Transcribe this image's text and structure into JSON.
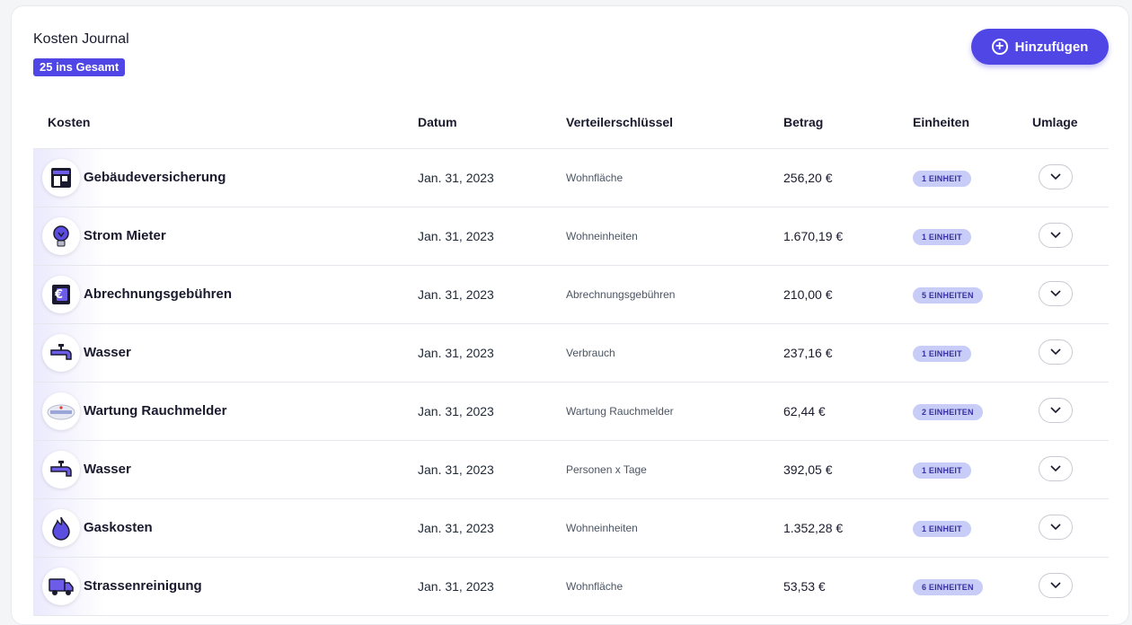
{
  "header": {
    "title": "Kosten Journal",
    "total_badge": "25 ins Gesamt",
    "add_button_label": "Hinzufügen"
  },
  "columns": {
    "kosten": "Kosten",
    "datum": "Datum",
    "verteilerschluessel": "Verteilerschlüssel",
    "betrag": "Betrag",
    "einheiten": "Einheiten",
    "umlage": "Umlage"
  },
  "rows": [
    {
      "icon": "building-icon",
      "name": "Gebäudeversicherung",
      "date": "Jan. 31, 2023",
      "key": "Wohnfläche",
      "amount": "256,20 €",
      "units": "1 EINHEIT"
    },
    {
      "icon": "lightbulb-icon",
      "name": "Strom Mieter",
      "date": "Jan. 31, 2023",
      "key": "Wohneinheiten",
      "amount": "1.670,19 €",
      "units": "1 EINHEIT"
    },
    {
      "icon": "euro-document-icon",
      "name": "Abrechnungsgebühren",
      "date": "Jan. 31, 2023",
      "key": "Abrechnungsgebühren",
      "amount": "210,00 €",
      "units": "5 EINHEITEN"
    },
    {
      "icon": "faucet-icon",
      "name": "Wasser",
      "date": "Jan. 31, 2023",
      "key": "Verbrauch",
      "amount": "237,16 €",
      "units": "1 EINHEIT"
    },
    {
      "icon": "smoke-detector-icon",
      "name": "Wartung Rauchmelder",
      "date": "Jan. 31, 2023",
      "key": "Wartung Rauchmelder",
      "amount": "62,44 €",
      "units": "2 EINHEITEN"
    },
    {
      "icon": "faucet-icon",
      "name": "Wasser",
      "date": "Jan. 31, 2023",
      "key": "Personen x Tage",
      "amount": "392,05 €",
      "units": "1 EINHEIT"
    },
    {
      "icon": "flame-icon",
      "name": "Gaskosten",
      "date": "Jan. 31, 2023",
      "key": "Wohneinheiten",
      "amount": "1.352,28 €",
      "units": "1 EINHEIT"
    },
    {
      "icon": "truck-icon",
      "name": "Strassenreinigung",
      "date": "Jan. 31, 2023",
      "key": "Wohnfläche",
      "amount": "53,53 €",
      "units": "6 EINHEITEN"
    }
  ],
  "colors": {
    "accent": "#4f46e5",
    "unit_badge_bg": "#c7cdf7",
    "unit_badge_text": "#3730a3"
  }
}
